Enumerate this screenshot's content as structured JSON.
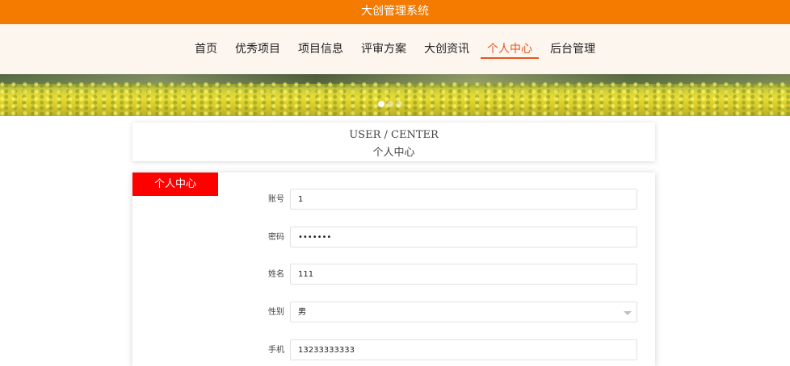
{
  "app": {
    "title": "大创管理系统"
  },
  "nav": {
    "items": [
      {
        "label": "首页",
        "active": false
      },
      {
        "label": "优秀项目",
        "active": false
      },
      {
        "label": "项目信息",
        "active": false
      },
      {
        "label": "评审方案",
        "active": false
      },
      {
        "label": "大创资讯",
        "active": false
      },
      {
        "label": "个人中心",
        "active": true
      },
      {
        "label": "后台管理",
        "active": false
      }
    ]
  },
  "carousel": {
    "total": 3,
    "current": 1
  },
  "section": {
    "title_en": "USER / CENTER",
    "title_cn": "个人中心"
  },
  "side": {
    "tab_label": "个人中心"
  },
  "form": {
    "account": {
      "label": "账号",
      "value": "1"
    },
    "password": {
      "label": "密码",
      "value": "•••••••"
    },
    "name": {
      "label": "姓名",
      "value": "111"
    },
    "gender": {
      "label": "性别",
      "value": "男"
    },
    "phone": {
      "label": "手机",
      "value": "13233333333"
    }
  },
  "colors": {
    "topbar": "#f57a00",
    "nav_bg": "#fcf6ef",
    "active": "#e9561f",
    "tab": "#ff0000"
  }
}
